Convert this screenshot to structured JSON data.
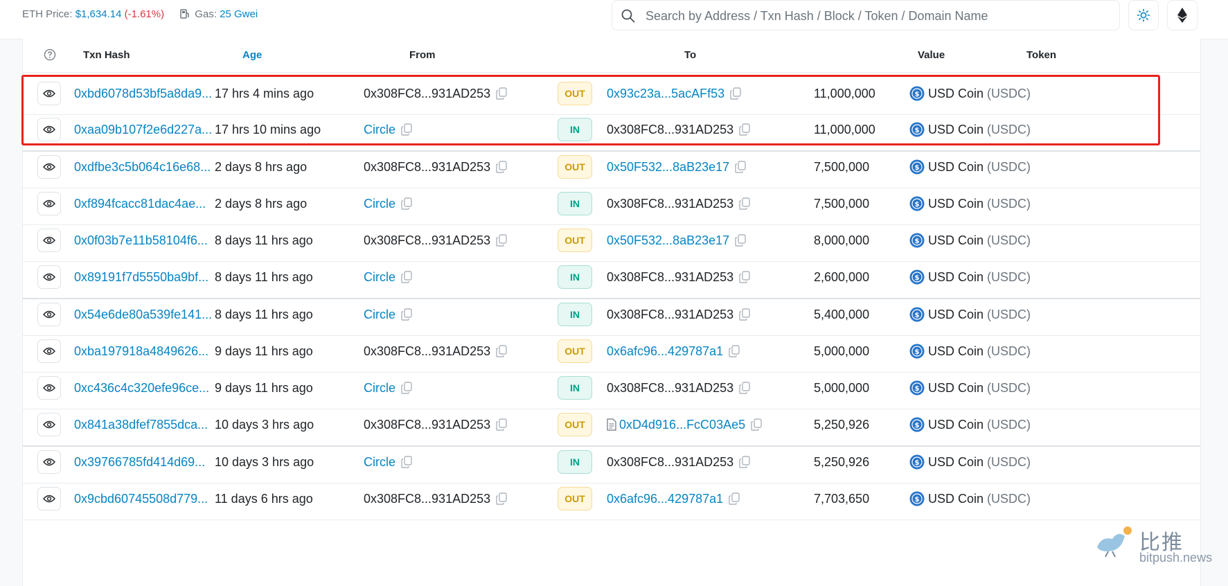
{
  "topbar": {
    "eth_price_label": "ETH Price: ",
    "eth_price_value": "$1,634.14",
    "eth_price_change": " (-1.61%)",
    "gas_label": "Gas: ",
    "gas_value": "25 Gwei",
    "search_placeholder": "Search by Address / Txn Hash / Block / Token / Domain Name",
    "theme_icon": "sun-icon",
    "network_icon": "ethereum-icon"
  },
  "table": {
    "columns": [
      "Txn Hash",
      "Age",
      "From",
      "To",
      "Value",
      "Token"
    ],
    "rows": [
      {
        "hash": "0xbd6078d53bf5a8da9...",
        "age": "17 hrs 4 mins ago",
        "from": "0x308FC8...931AD253",
        "from_link": false,
        "dir": "OUT",
        "to": "0x93c23a...5acAFf53",
        "to_link": true,
        "to_contract": false,
        "value": "11,000,000",
        "token_name": "USD Coin",
        "token_symbol": "(USDC)"
      },
      {
        "hash": "0xaa09b107f2e6d227a...",
        "age": "17 hrs 10 mins ago",
        "from": "Circle",
        "from_link": true,
        "dir": "IN",
        "to": "0x308FC8...931AD253",
        "to_link": false,
        "to_contract": false,
        "value": "11,000,000",
        "token_name": "USD Coin",
        "token_symbol": "(USDC)"
      },
      {
        "hash": "0xdfbe3c5b064c16e68...",
        "age": "2 days 8 hrs ago",
        "from": "0x308FC8...931AD253",
        "from_link": false,
        "dir": "OUT",
        "to": "0x50F532...8aB23e17",
        "to_link": true,
        "to_contract": false,
        "value": "7,500,000",
        "token_name": "USD Coin",
        "token_symbol": "(USDC)"
      },
      {
        "hash": "0xf894fcacc81dac4ae...",
        "age": "2 days 8 hrs ago",
        "from": "Circle",
        "from_link": true,
        "dir": "IN",
        "to": "0x308FC8...931AD253",
        "to_link": false,
        "to_contract": false,
        "value": "7,500,000",
        "token_name": "USD Coin",
        "token_symbol": "(USDC)"
      },
      {
        "hash": "0x0f03b7e11b58104f6...",
        "age": "8 days 11 hrs ago",
        "from": "0x308FC8...931AD253",
        "from_link": false,
        "dir": "OUT",
        "to": "0x50F532...8aB23e17",
        "to_link": true,
        "to_contract": false,
        "value": "8,000,000",
        "token_name": "USD Coin",
        "token_symbol": "(USDC)"
      },
      {
        "hash": "0x89191f7d5550ba9bf...",
        "age": "8 days 11 hrs ago",
        "from": "Circle",
        "from_link": true,
        "dir": "IN",
        "to": "0x308FC8...931AD253",
        "to_link": false,
        "to_contract": false,
        "value": "2,600,000",
        "token_name": "USD Coin",
        "token_symbol": "(USDC)"
      },
      {
        "hash": "0x54e6de80a539fe141...",
        "age": "8 days 11 hrs ago",
        "from": "Circle",
        "from_link": true,
        "dir": "IN",
        "to": "0x308FC8...931AD253",
        "to_link": false,
        "to_contract": false,
        "value": "5,400,000",
        "token_name": "USD Coin",
        "token_symbol": "(USDC)"
      },
      {
        "hash": "0xba197918a4849626...",
        "age": "9 days 11 hrs ago",
        "from": "0x308FC8...931AD253",
        "from_link": false,
        "dir": "OUT",
        "to": "0x6afc96...429787a1",
        "to_link": true,
        "to_contract": false,
        "value": "5,000,000",
        "token_name": "USD Coin",
        "token_symbol": "(USDC)"
      },
      {
        "hash": "0xc436c4c320efe96ce...",
        "age": "9 days 11 hrs ago",
        "from": "Circle",
        "from_link": true,
        "dir": "IN",
        "to": "0x308FC8...931AD253",
        "to_link": false,
        "to_contract": false,
        "value": "5,000,000",
        "token_name": "USD Coin",
        "token_symbol": "(USDC)"
      },
      {
        "hash": "0x841a38dfef7855dca...",
        "age": "10 days 3 hrs ago",
        "from": "0x308FC8...931AD253",
        "from_link": false,
        "dir": "OUT",
        "to": "0xD4d916...FcC03Ae5",
        "to_link": true,
        "to_contract": true,
        "value": "5,250,926",
        "token_name": "USD Coin",
        "token_symbol": "(USDC)"
      },
      {
        "hash": "0x39766785fd414d69...",
        "age": "10 days 3 hrs ago",
        "from": "Circle",
        "from_link": true,
        "dir": "IN",
        "to": "0x308FC8...931AD253",
        "to_link": false,
        "to_contract": false,
        "value": "5,250,926",
        "token_name": "USD Coin",
        "token_symbol": "(USDC)"
      },
      {
        "hash": "0x9cbd60745508d779...",
        "age": "11 days 6 hrs ago",
        "from": "0x308FC8...931AD253",
        "from_link": false,
        "dir": "OUT",
        "to": "0x6afc96...429787a1",
        "to_link": true,
        "to_contract": false,
        "value": "7,703,650",
        "token_name": "USD Coin",
        "token_symbol": "(USDC)"
      }
    ]
  },
  "watermark": {
    "cn": "比推",
    "en": "bitpush.news"
  },
  "colors": {
    "link": "#0784c3",
    "negative": "#dc3545",
    "out": "#cc9a06",
    "in": "#00a186",
    "highlight": "#e8221a"
  }
}
